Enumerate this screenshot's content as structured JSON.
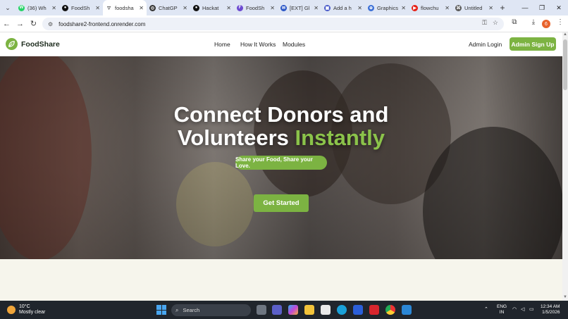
{
  "browser": {
    "tabs": [
      {
        "label": "(36) Wh",
        "icon": "whatsapp-icon",
        "color": "#25d366",
        "glyph": "W"
      },
      {
        "label": "FoodSh",
        "icon": "github-icon",
        "color": "#111111",
        "glyph": "●"
      },
      {
        "label": "foodsha",
        "icon": "vercel-icon",
        "color": "#ffffff",
        "glyph": "▽",
        "active": true
      },
      {
        "label": "ChatGP",
        "icon": "chatgpt-icon",
        "color": "#333333",
        "glyph": "◎"
      },
      {
        "label": "Hackat",
        "icon": "github-icon",
        "color": "#111111",
        "glyph": "●"
      },
      {
        "label": "FoodSh",
        "icon": "app-icon",
        "color": "#6c4ad0",
        "glyph": "F"
      },
      {
        "label": "[EXT] Gl",
        "icon": "mail-icon",
        "color": "#2a56c6",
        "glyph": "✉"
      },
      {
        "label": "Add a h",
        "icon": "bookmark-icon",
        "color": "#4a5bc9",
        "glyph": "▣"
      },
      {
        "label": "Graphics",
        "icon": "globe-icon",
        "color": "#3b6fd6",
        "glyph": "⊕"
      },
      {
        "label": "flowchu",
        "icon": "youtube-icon",
        "color": "#e62117",
        "glyph": "▶"
      },
      {
        "label": "Untitled",
        "icon": "drawio-icon",
        "color": "#5a5a5a",
        "glyph": "⌘"
      }
    ],
    "new_tab_glyph": "+",
    "url": "foodshare2-frontend.onrender.com",
    "profile_initial": "6"
  },
  "site": {
    "brand": "FoodShare",
    "nav": [
      "Home",
      "How It Works",
      "Modules"
    ],
    "admin_login": "Admin Login",
    "signup": "Admin Sign Up",
    "accent_color": "#7cb342"
  },
  "hero": {
    "title_line1": "Connect Donors and",
    "title_line2_a": "Volunteers ",
    "title_line2_b": "Instantly",
    "tagline": "Share your Food, Share your Love.",
    "cta": "Get Started"
  },
  "taskbar": {
    "temperature": "10°C",
    "condition": "Mostly clear",
    "search_placeholder": "Search",
    "lang_top": "ENG",
    "lang_bottom": "IN",
    "time": "12:34 AM",
    "date": "1/5/2026"
  }
}
